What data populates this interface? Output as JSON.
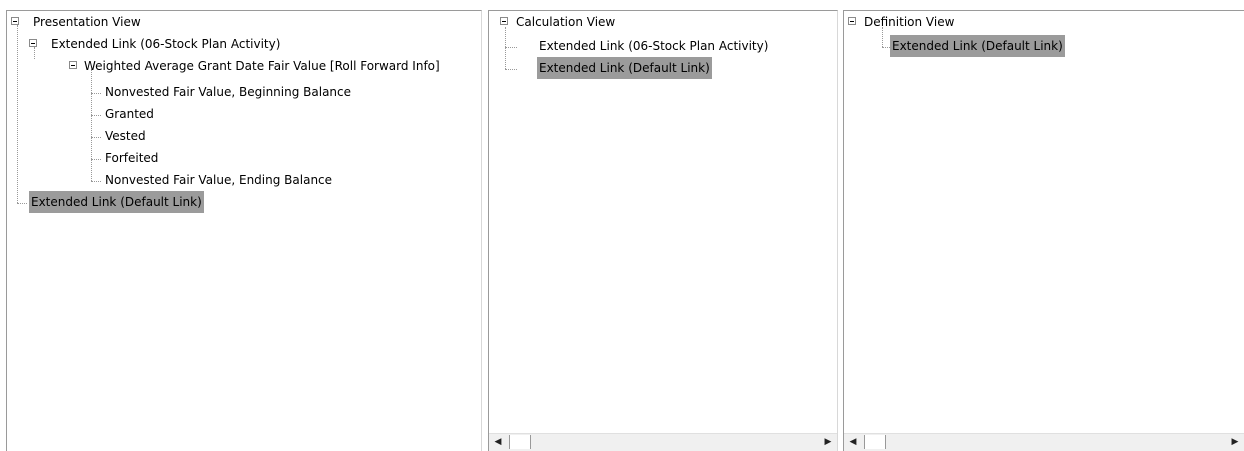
{
  "presentation": {
    "root": "Presentation View",
    "extended_link_stock": "Extended Link (06-Stock Plan Activity)",
    "weighted_avg": "Weighted Average Grant Date Fair Value [Roll Forward Info]",
    "items": [
      "Nonvested Fair Value, Beginning Balance",
      "Granted",
      "Vested",
      "Forfeited",
      "Nonvested Fair Value, Ending Balance"
    ],
    "default_link": "Extended Link (Default Link)"
  },
  "calculation": {
    "root": "Calculation View",
    "items": [
      "Extended Link (06-Stock Plan Activity)",
      "Extended Link (Default Link)"
    ]
  },
  "definition": {
    "root": "Definition View",
    "items": [
      "Extended Link (Default Link)"
    ]
  },
  "scrollbar": {
    "left_arrow": "◀",
    "right_arrow": "▶"
  }
}
